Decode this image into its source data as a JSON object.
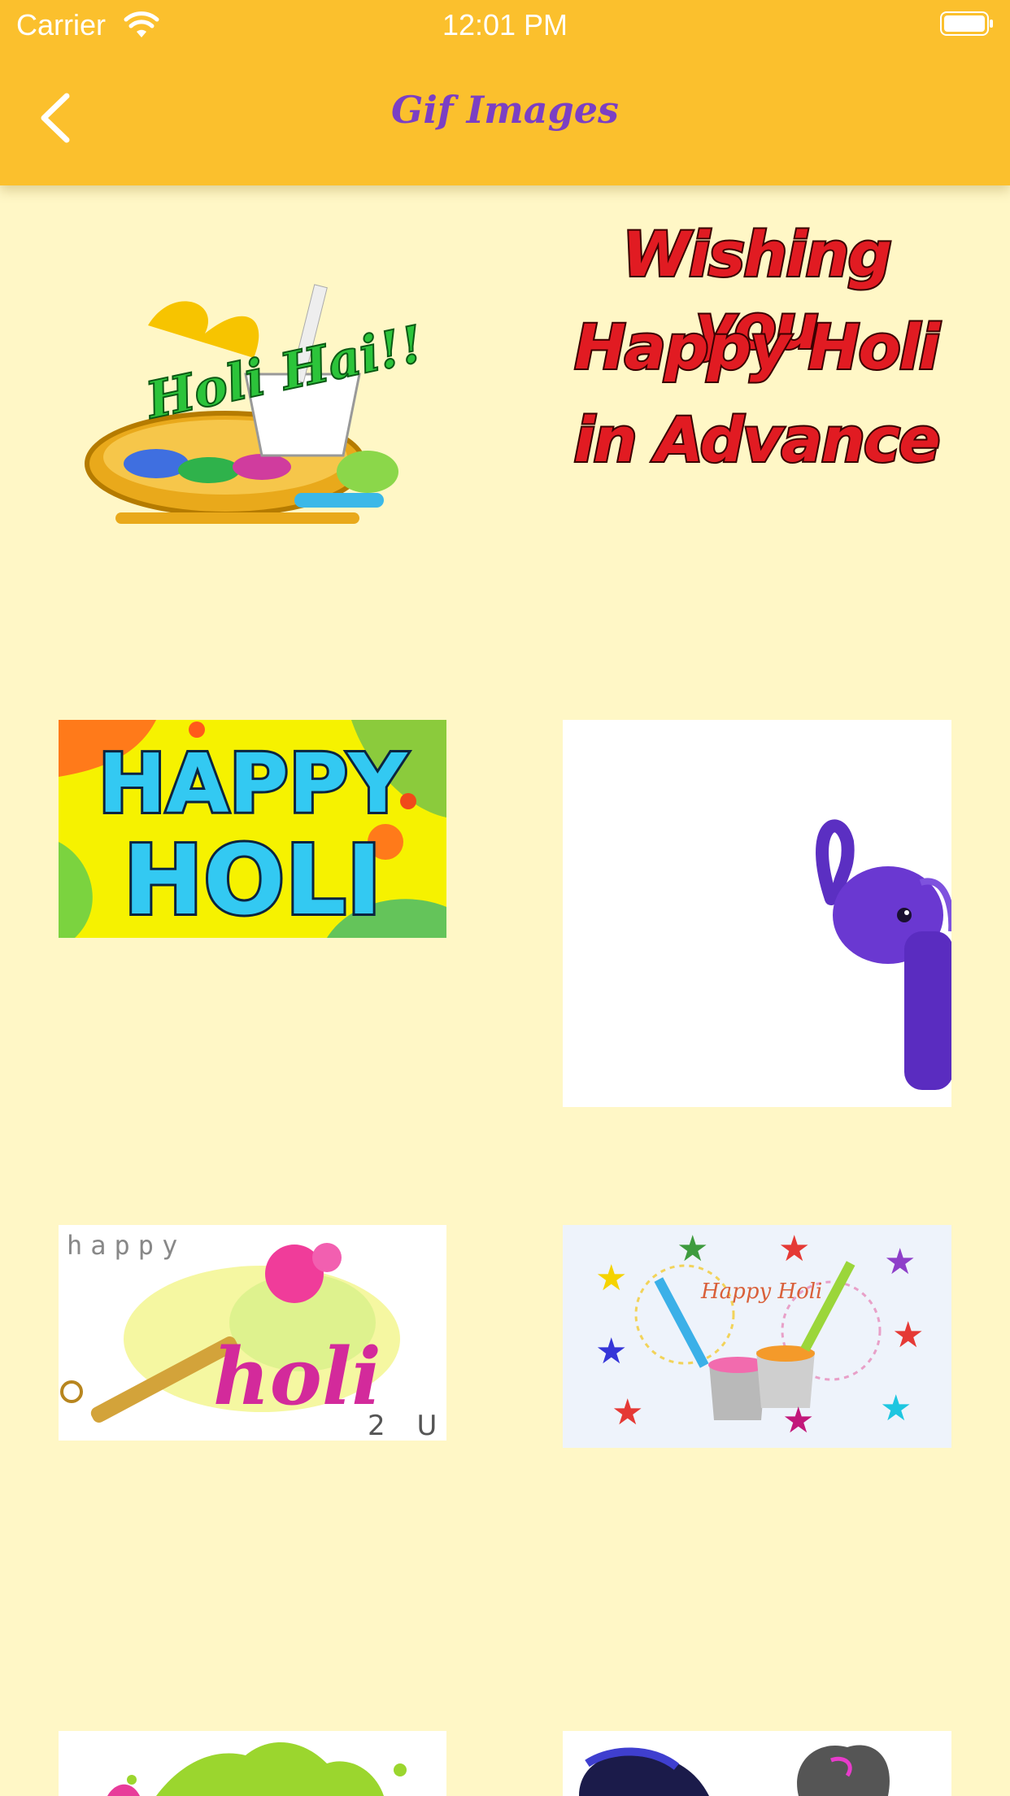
{
  "status_bar": {
    "carrier": "Carrier",
    "time": "12:01 PM"
  },
  "nav": {
    "title": "Gif Images",
    "back_icon": "chevron-left-icon"
  },
  "colors": {
    "nav_background": "#FBC02D",
    "page_background": "#FFF7C6",
    "title": "#7B3FC4"
  },
  "gifs": [
    {
      "text": "Holi Hai!!"
    },
    {
      "lines": [
        "Wishing you",
        "Happy Holi",
        "in Advance"
      ]
    },
    {
      "lines": [
        "HAPPY",
        "HOLI"
      ]
    },
    {
      "text": ""
    },
    {
      "top": "happy",
      "main": "holi",
      "suffix": "2 U"
    },
    {
      "text": "Happy Holi"
    },
    {
      "text": ""
    },
    {
      "text": ""
    }
  ]
}
